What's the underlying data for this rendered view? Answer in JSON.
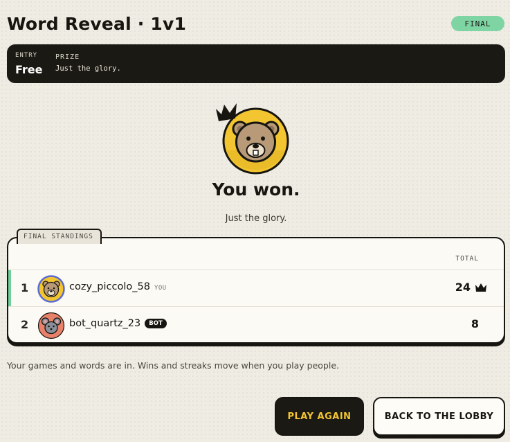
{
  "game": {
    "title": "Word Reveal · 1v1",
    "status": "FINAL"
  },
  "info": {
    "entry_label": "ENTRY",
    "entry_value": "Free",
    "prize_label": "PRIZE",
    "prize_value": "Just the glory."
  },
  "result": {
    "heading": "You won.",
    "subtitle": "Just the glory."
  },
  "standings": {
    "tab_label": "FINAL STANDINGS",
    "total_header": "TOTAL",
    "rows": [
      {
        "rank": "1",
        "name": "cozy_piccolo_58",
        "tag": "YOU",
        "score": "24",
        "avatar": "bear-icon",
        "winner": true
      },
      {
        "rank": "2",
        "name": "bot_quartz_23",
        "tag": "BOT",
        "score": "8",
        "avatar": "mouse-icon",
        "winner": false
      }
    ]
  },
  "footnote": "Your games and words are in. Wins and streaks move when you play people.",
  "buttons": {
    "play_again": "PLAY AGAIN",
    "back_to_lobby": "BACK TO THE LOBBY"
  },
  "colors": {
    "background": "#efece4",
    "dark": "#1b1913",
    "accent_yellow": "#f2c531",
    "accent_green": "#7fd4a4",
    "mouse_avatar_bg": "#e8816a"
  }
}
